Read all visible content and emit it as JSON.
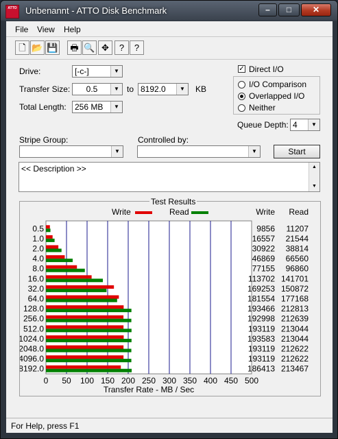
{
  "window": {
    "title": "Unbenannt - ATTO Disk Benchmark",
    "icon_text": "ATTO"
  },
  "window_buttons": {
    "minimize": "–",
    "maximize": "□",
    "close": "✕"
  },
  "menu": [
    "File",
    "View",
    "Help"
  ],
  "toolbar": {
    "icons": [
      "new-icon",
      "open-icon",
      "save-icon",
      "print-icon",
      "print-preview-icon",
      "move-icon",
      "help-icon",
      "context-help-icon"
    ],
    "glyphs": [
      "🗋",
      "📂",
      "💾",
      "🖶",
      "🔍",
      "✥",
      "?",
      "?"
    ]
  },
  "settings": {
    "drive_label": "Drive:",
    "drive_value": "[-c-]",
    "transfer_size_label": "Transfer Size:",
    "transfer_from": "0.5",
    "to_label": "to",
    "transfer_to": "8192.0",
    "unit": "KB",
    "total_length_label": "Total Length:",
    "total_length_value": "256 MB",
    "direct_io_label": "Direct I/O",
    "direct_io_checked": true,
    "io_comparison_label": "I/O Comparison",
    "overlapped_io_label": "Overlapped I/O",
    "neither_label": "Neither",
    "selected_mode": "overlapped",
    "queue_depth_label": "Queue Depth:",
    "queue_depth_value": "4",
    "stripe_group_label": "Stripe Group:",
    "stripe_group_value": "",
    "controlled_by_label": "Controlled by:",
    "controlled_by_value": "",
    "start_label": "Start",
    "description": "<< Description >>"
  },
  "results_title": "Test Results",
  "chart_data": {
    "type": "bar",
    "orientation": "horizontal",
    "categories": [
      "0.5",
      "1.0",
      "2.0",
      "4.0",
      "8.0",
      "16.0",
      "32.0",
      "64.0",
      "128.0",
      "256.0",
      "512.0",
      "1024.0",
      "2048.0",
      "4096.0",
      "8192.0"
    ],
    "series": [
      {
        "name": "Write",
        "color": "#e00000",
        "values": [
          9856,
          16557,
          30922,
          46869,
          77155,
          113702,
          169253,
          181554,
          193466,
          192998,
          193119,
          193583,
          193119,
          193119,
          186413
        ]
      },
      {
        "name": "Read",
        "color": "#008000",
        "values": [
          11207,
          21544,
          38814,
          66560,
          96860,
          141701,
          150872,
          177168,
          212813,
          212639,
          213044,
          213044,
          212622,
          212622,
          213467
        ]
      }
    ],
    "table_headers": {
      "write": "Write",
      "read": "Read"
    },
    "xlabel": "Transfer Rate - MB / Sec",
    "xticks": [
      "0",
      "50",
      "100",
      "150",
      "200",
      "250",
      "300",
      "350",
      "400",
      "450",
      "500"
    ],
    "xlim": [
      0,
      500
    ],
    "legend": "top"
  },
  "status": "For Help, press F1"
}
